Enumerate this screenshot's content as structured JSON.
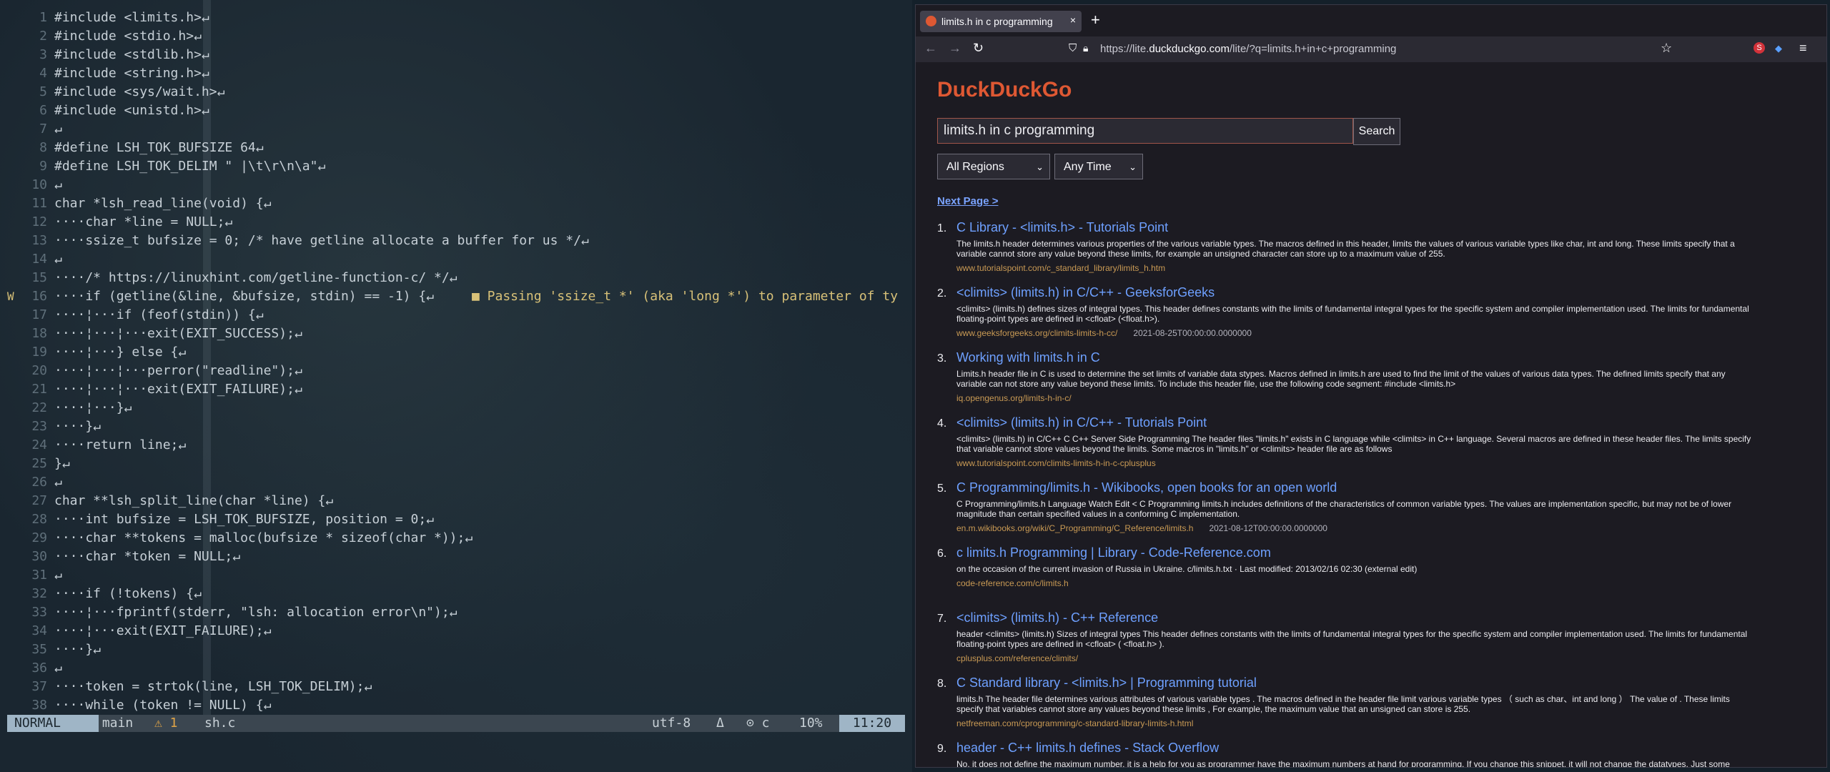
{
  "editor": {
    "lines": [
      {
        "n": "1",
        "t": "#include <limits.h>↵"
      },
      {
        "n": "2",
        "t": "#include <stdio.h>↵"
      },
      {
        "n": "3",
        "t": "#include <stdlib.h>↵"
      },
      {
        "n": "4",
        "t": "#include <string.h>↵"
      },
      {
        "n": "5",
        "t": "#include <sys/wait.h>↵"
      },
      {
        "n": "6",
        "t": "#include <unistd.h>↵"
      },
      {
        "n": "7",
        "t": "↵"
      },
      {
        "n": "8",
        "t": "#define LSH_TOK_BUFSIZE 64↵"
      },
      {
        "n": "9",
        "t": "#define LSH_TOK_DELIM \" |\\t\\r\\n\\a\"↵"
      },
      {
        "n": "10",
        "t": "↵"
      },
      {
        "n": "11",
        "t": "char *lsh_read_line(void) {↵"
      },
      {
        "n": "12",
        "t": "····char *line = NULL;↵"
      },
      {
        "n": "13",
        "t": "····ssize_t bufsize = 0; /* have getline allocate a buffer for us */↵"
      },
      {
        "n": "14",
        "t": "↵"
      },
      {
        "n": "15",
        "t": "····/* https://linuxhint.com/getline-function-c/ */↵"
      },
      {
        "n": "16",
        "t": "····if (getline(&line, &bufsize, stdin) == -1) {↵",
        "sign": "W",
        "virt": "■ Passing 'ssize_t *' (aka 'long *') to parameter of ty"
      },
      {
        "n": "17",
        "t": "····¦···if (feof(stdin)) {↵"
      },
      {
        "n": "18",
        "t": "····¦···¦···exit(EXIT_SUCCESS);↵"
      },
      {
        "n": "19",
        "t": "····¦···} else {↵"
      },
      {
        "n": "20",
        "t": "····¦···¦···perror(\"readline\");↵"
      },
      {
        "n": "21",
        "t": "····¦···¦···exit(EXIT_FAILURE);↵"
      },
      {
        "n": "22",
        "t": "····¦···}↵"
      },
      {
        "n": "23",
        "t": "····}↵"
      },
      {
        "n": "24",
        "t": "····return line;↵"
      },
      {
        "n": "25",
        "t": "}↵"
      },
      {
        "n": "26",
        "t": "↵"
      },
      {
        "n": "27",
        "t": "char **lsh_split_line(char *line) {↵"
      },
      {
        "n": "28",
        "t": "····int bufsize = LSH_TOK_BUFSIZE, position = 0;↵"
      },
      {
        "n": "29",
        "t": "····char **tokens = malloc(bufsize * sizeof(char *));↵"
      },
      {
        "n": "30",
        "t": "····char *token = NULL;↵"
      },
      {
        "n": "31",
        "t": "↵"
      },
      {
        "n": "32",
        "t": "····if (!tokens) {↵"
      },
      {
        "n": "33",
        "t": "····¦···fprintf(stderr, \"lsh: allocation error\\n\");↵"
      },
      {
        "n": "34",
        "t": "····¦···exit(EXIT_FAILURE);↵"
      },
      {
        "n": "35",
        "t": "····}↵"
      },
      {
        "n": "36",
        "t": "↵"
      },
      {
        "n": "37",
        "t": "····token = strtok(line, LSH_TOK_DELIM);↵"
      },
      {
        "n": "38",
        "t": "····while (token != NULL) {↵"
      }
    ],
    "status": {
      "mode": "NORMAL",
      "branch": " main",
      "warnings": "⚠ 1",
      "file": "sh.c",
      "encoding": "utf-8",
      "format_icon": "Δ",
      "filetype": "⊙ c",
      "percent": "10%",
      "position": "11:20"
    }
  },
  "browser": {
    "tab_title": "limits.h in c programming",
    "tab_close": "×",
    "new_tab": "+",
    "url_prefix": "https://lite.",
    "url_host": "duckduckgo.com",
    "url_path": "/lite/?q=limits.h+in+c+programming",
    "logo": "DuckDuckGo",
    "search_value": "limits.h in c programming",
    "search_button": "Search",
    "region_select": "All Regions",
    "time_select": "Any Time",
    "next_page": "Next Page >",
    "results": [
      {
        "num": "1.",
        "title": "C Library - <limits.h> - Tutorials Point",
        "snippet": "The limits.h header determines various properties of the various variable types. The macros defined in this header, limits the values of various variable types like char, int and long. These limits specify that a variable cannot store any value beyond these limits, for example an unsigned character can store up to a maximum value of 255.",
        "url": "www.tutorialspoint.com/c_standard_library/limits_h.htm",
        "date": ""
      },
      {
        "num": "2.",
        "title": "<climits> (limits.h) in C/C++ - GeeksforGeeks",
        "snippet": "<climits> (limits.h) defines sizes of integral types. This header defines constants with the limits of fundamental integral types for the specific system and compiler implementation used. The limits for fundamental floating-point types are defined in <cfloat> (<float.h>).",
        "url": "www.geeksforgeeks.org/climits-limits-h-cc/",
        "date": "2021-08-25T00:00:00.0000000"
      },
      {
        "num": "3.",
        "title": "Working with limits.h in C",
        "snippet": "Limits.h header file in C is used to determine the set limits of variable data stypes. Macros defined in limits.h are used to find the limit of the values of various data types. The defined limits specify that any variable can not store any value beyond these limits. To include this header file, use the following code segment: #include <limits.h>",
        "url": "iq.opengenus.org/limits-h-in-c/",
        "date": ""
      },
      {
        "num": "4.",
        "title": "<climits> (limits.h) in C/C++ - Tutorials Point",
        "snippet": "<climits> (limits.h) in C/C++ C C++ Server Side Programming The header files \"limits.h\" exists in C language while <climits> in C++ language. Several macros are defined in these header files. The limits specify that variable cannot store values beyond the limits. Some macros in \"limits.h\" or <climits> header file are as follows",
        "url": "www.tutorialspoint.com/climits-limits-h-in-c-cplusplus",
        "date": ""
      },
      {
        "num": "5.",
        "title": "C Programming/limits.h - Wikibooks, open books for an open world",
        "snippet": "C Programming/limits.h Language Watch Edit < C Programming limits.h includes definitions of the characteristics of common variable types. The values are implementation specific, but may not be of lower magnitude than certain specified values in a conforming C implementation.",
        "url": "en.m.wikibooks.org/wiki/C_Programming/C_Reference/limits.h",
        "date": "2021-08-12T00:00:00.0000000"
      },
      {
        "num": "6.",
        "title": "c limits.h Programming | Library - Code-Reference.com",
        "snippet": "on the occasion of the current invasion of Russia in Ukraine. c/limits.h.txt · Last modified: 2013/02/16 02:30 (external edit)",
        "url": "code-reference.com/c/limits.h",
        "date": ""
      },
      {
        "num": "7.",
        "title": "<climits> (limits.h) - C++ Reference",
        "snippet": "header <climits> (limits.h) Sizes of integral types This header defines constants with the limits of fundamental integral types for the specific system and compiler implementation used. The limits for fundamental floating-point types are defined in <cfloat> ( <float.h> ).",
        "url": "cplusplus.com/reference/climits/",
        "date": ""
      },
      {
        "num": "8.",
        "title": "C Standard library - <limits.h> | Programming tutorial",
        "snippet": "limits.h The header file determines various attributes of various variable types . The macros defined in the header file limit various variable types （ such as char、int and long ） The value of . These limits specify that variables cannot store any values beyond these limits , For example, the maximum value that an unsigned can store is 255.",
        "url": "netfreeman.com/cprogramming/c-standard-library-limits-h.html",
        "date": ""
      },
      {
        "num": "9.",
        "title": "header - C++ limits.h defines - Stack Overflow",
        "snippet": "No, it does not define the maximum number, it is a help for you as programmer have the maximum numbers at hand for programming. If you change this snippet, it will not change the datatypes. Just some",
        "url": "",
        "date": ""
      }
    ]
  }
}
